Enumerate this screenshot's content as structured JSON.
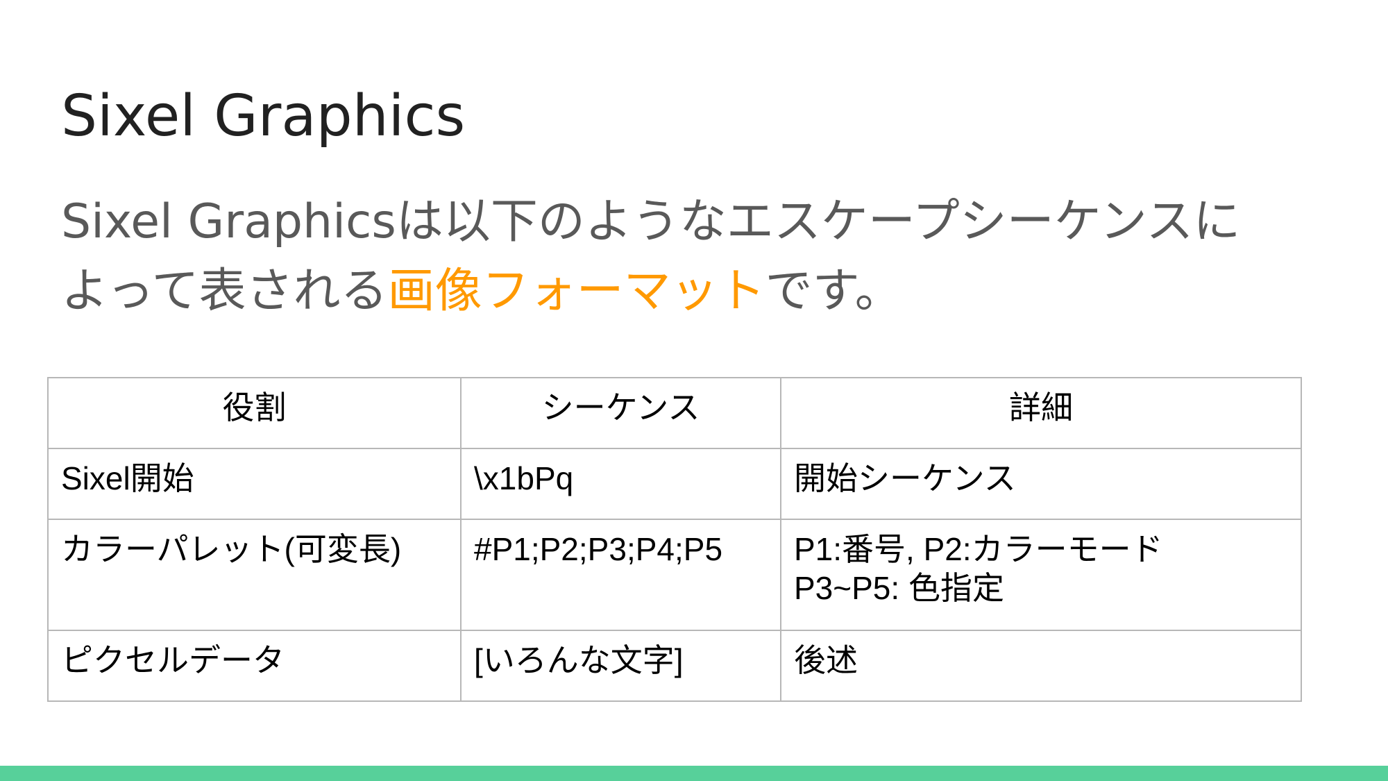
{
  "slide": {
    "title": "Sixel Graphics",
    "body_line1": "Sixel Graphicsは以下のようなエスケープシーケンスに",
    "body_line2_before": "よって表される",
    "body_line2_highlight": "画像フォーマット",
    "body_line2_after": "です。"
  },
  "table": {
    "headers": [
      "役割",
      "シーケンス",
      "詳細"
    ],
    "rows": [
      {
        "role": "Sixel開始",
        "sequence": "\\x1bPq",
        "detail_lines": [
          "開始シーケンス"
        ]
      },
      {
        "role": "カラーパレット(可変長)",
        "sequence": "#P1;P2;P3;P4;P5",
        "detail_lines": [
          "P1:番号, P2:カラーモード",
          "P3~P5: 色指定"
        ]
      },
      {
        "role": "ピクセルデータ",
        "sequence": "[いろんな文字]",
        "detail_lines": [
          "後述"
        ]
      }
    ]
  },
  "colors": {
    "title": "#212121",
    "body": "#595959",
    "highlight": "#ff9900",
    "table_border": "#b7b7b7",
    "footer_bar": "#57d09a"
  }
}
